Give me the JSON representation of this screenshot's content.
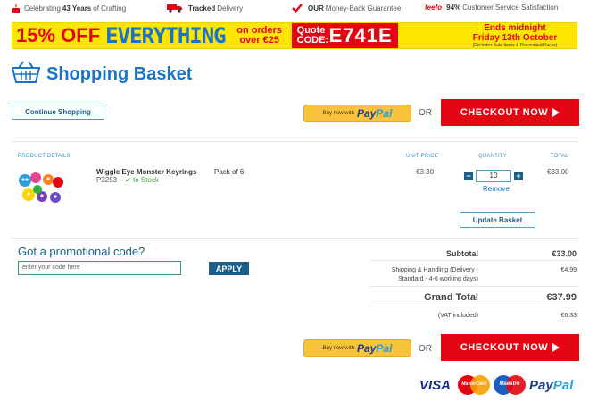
{
  "usp_bar": {
    "crafting": {
      "pre": "Celebrating",
      "bold": "43 Years",
      "post": "of Crafting"
    },
    "delivery": {
      "bold": "Tracked",
      "post": "Delivery"
    },
    "guarantee": {
      "bold": "OUR",
      "post": "Money-Back Guarantee"
    },
    "feefo": {
      "brand": "feefo",
      "bold": "94%",
      "post": "Customer Service Satisfaction"
    }
  },
  "banner": {
    "headline": "15% OFF",
    "everything": "EVERYTHING",
    "on_orders": "on orders",
    "over": "over €25",
    "quote_label": "Quote CODE:",
    "quote_code": "E741E",
    "ends_line1": "Ends midnight",
    "ends_line2": "Friday 13th October",
    "ends_note": "(Excludes Sale Items & Discounted Packs)"
  },
  "page_title": "Shopping Basket",
  "actions": {
    "continue_shopping": "Continue Shopping",
    "paypal_prefix": "Buy now with",
    "paypal_brand_1": "Pay",
    "paypal_brand_2": "Pal",
    "or": "OR",
    "checkout": "CHECKOUT NOW"
  },
  "table": {
    "headers": {
      "product_details": "PRODUCT DETAILS",
      "unit_price": "UNIT PRICE",
      "quantity": "QUANTITY",
      "total": "TOTAL"
    },
    "items": [
      {
        "name": "Wiggle Eye Monster Keyrings",
        "code": "P3253",
        "separator": "–",
        "stock": "In Stock",
        "pack": "Pack of 6",
        "unit_price": "€3.30",
        "quantity": "10",
        "remove": "Remove",
        "total": "€33.00"
      }
    ],
    "update_basket": "Update Basket"
  },
  "promo": {
    "title": "Got a promotional code?",
    "placeholder": "enter your code here",
    "apply": "APPLY"
  },
  "summary": {
    "subtotal_label": "Subtotal",
    "subtotal_value": "€33.00",
    "shipping_label_1": "Shipping & Handling (Delivery -",
    "shipping_label_2": "Standard - 4-6 working days)",
    "shipping_value": "€4.99",
    "grand_total_label": "Grand Total",
    "grand_total_value": "€37.99",
    "vat_label": "(VAT included)",
    "vat_value": "€6.33"
  },
  "payment_cards": {
    "visa": "VISA",
    "mastercard": "MasterCard",
    "maestro": "Maestro",
    "paypal_1": "Pay",
    "paypal_2": "Pal"
  },
  "colors": {
    "brand_blue": "#1a73c9",
    "checkout_red": "#e30613",
    "banner_yellow": "#ffe600",
    "paypal_gold": "#f7c23c",
    "in_stock_green": "#3aa83a"
  }
}
